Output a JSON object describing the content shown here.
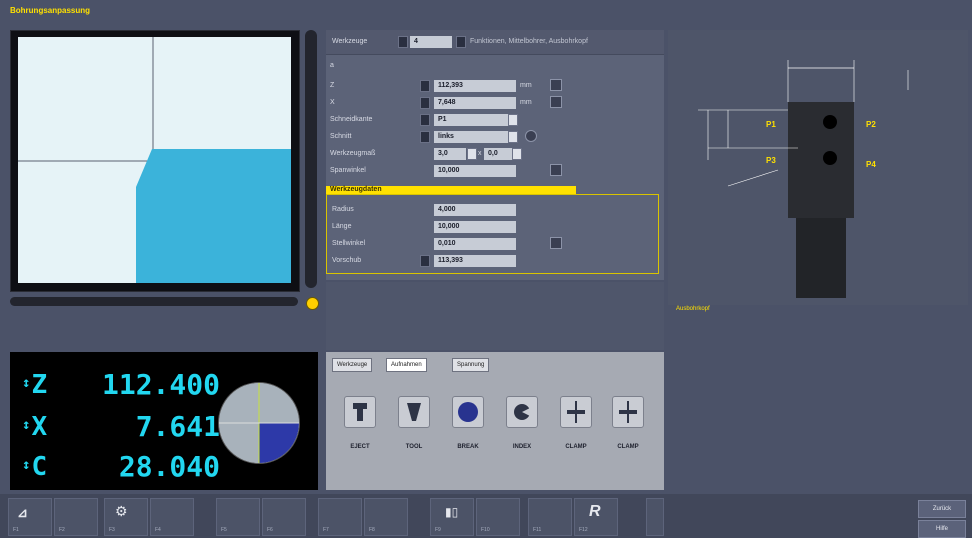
{
  "header": {
    "title": "Bohrungsanpassung"
  },
  "dro": {
    "rows": [
      {
        "axis": "Z",
        "value": "112.400"
      },
      {
        "axis": "X",
        "value": "7.641"
      },
      {
        "axis": "C",
        "value": "28.040"
      }
    ]
  },
  "form": {
    "head": {
      "label": "Werkzeuge",
      "select_value": "4",
      "hint": "Funktionen, Mittelbohrer, Ausbohrkopf"
    },
    "section_label": "a",
    "rows": [
      {
        "label": "Z",
        "value": "112,393",
        "unit": "mm"
      },
      {
        "label": "X",
        "value": "7,648",
        "unit": "mm"
      },
      {
        "label": "Schneidkante",
        "value": "P1"
      },
      {
        "label": "Schnitt",
        "value": "links"
      },
      {
        "label": "Werkzeugmaß",
        "value": "3,0",
        "value2": "0,0"
      },
      {
        "label": "Spanwinkel",
        "value": "10,000"
      }
    ],
    "highlight_title": "Werkzeugdaten",
    "box_rows": [
      {
        "label": "Radius",
        "value": "4,000"
      },
      {
        "label": "Länge",
        "value": "10,000"
      },
      {
        "label": "Stellwinkel",
        "value": "0,010"
      },
      {
        "label": "Vorschub",
        "value": "113,393"
      }
    ]
  },
  "tool_panel": {
    "tabs": [
      "Werkzeuge",
      "Aufnahmen",
      "Spannung"
    ],
    "active_tab": 1,
    "buttons": [
      {
        "label": "EJECT",
        "icon": "eject-icon"
      },
      {
        "label": "TOOL",
        "icon": "tool-icon"
      },
      {
        "label": "BREAK",
        "icon": "break-icon"
      },
      {
        "label": "INDEX",
        "icon": "index-icon"
      },
      {
        "label": "CLAMP",
        "icon": "clamp-icon"
      },
      {
        "label": "CLAMP",
        "icon": "clamp-icon"
      }
    ]
  },
  "diagram": {
    "labels": {
      "p1": "P1",
      "p2": "P2",
      "p3": "P3",
      "p4": "P4"
    },
    "caption": "Ausbohrkopf"
  },
  "softkeys": [
    {
      "num": "F1",
      "icon": "measure-icon"
    },
    {
      "num": "F2",
      "icon": ""
    },
    {
      "num": "F3",
      "icon": "tool-change-icon"
    },
    {
      "num": "F4",
      "icon": ""
    },
    {
      "num": "F5",
      "icon": ""
    },
    {
      "num": "F6",
      "icon": ""
    },
    {
      "num": "F7",
      "icon": ""
    },
    {
      "num": "F8",
      "icon": ""
    },
    {
      "num": "F9",
      "icon": "graph-icon"
    },
    {
      "num": "F10",
      "icon": ""
    },
    {
      "num": "F11",
      "icon": ""
    },
    {
      "num": "F12",
      "icon": "reset-icon"
    }
  ],
  "side_buttons": [
    {
      "label": "Zurück"
    },
    {
      "label": "Hilfe"
    }
  ],
  "colors": {
    "accent": "#ffe100",
    "dro_text": "#22d7f0",
    "preview_bg": "#e6f3f7",
    "workpiece": "#3bb3da"
  }
}
